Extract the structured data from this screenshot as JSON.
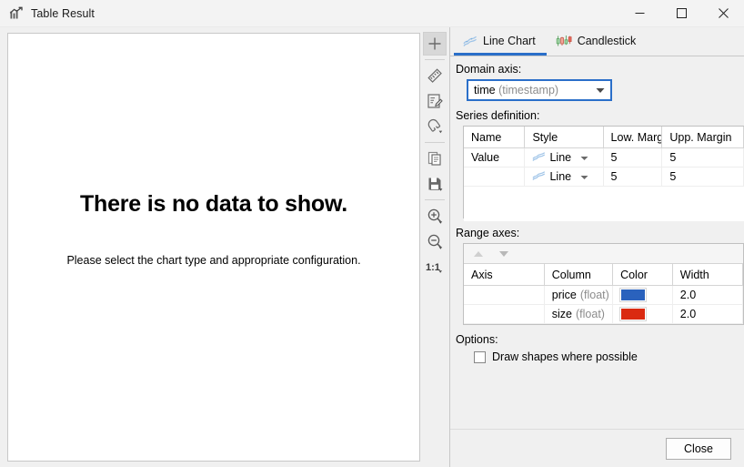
{
  "window": {
    "title": "Table Result",
    "icon": "chart-icon",
    "controls": {
      "minimize": "minimize-icon",
      "maximize": "maximize-icon",
      "close": "close-icon"
    }
  },
  "canvas": {
    "message_title": "There is no data to show.",
    "message_sub": "Please select the chart type and appropriate configuration."
  },
  "toolbar": {
    "items": [
      {
        "name": "crosshair-icon",
        "tooltip": "Select / move",
        "selected": true
      },
      {
        "name": "ruler-icon",
        "tooltip": "Measure",
        "selected": false
      },
      {
        "name": "edit-note-icon",
        "tooltip": "Annotate",
        "selected": false
      },
      {
        "name": "magnet-icon",
        "tooltip": "Snap",
        "selected": false
      },
      {
        "name": "copy-icon",
        "tooltip": "Copy",
        "selected": false
      },
      {
        "name": "save-icon",
        "tooltip": "Save",
        "selected": false
      },
      {
        "name": "zoom-in-icon",
        "tooltip": "Zoom in",
        "selected": false
      },
      {
        "name": "zoom-out-icon",
        "tooltip": "Zoom out",
        "selected": false
      },
      {
        "name": "zoom-reset-icon",
        "label": "1:1",
        "tooltip": "Zoom 1:1",
        "selected": false
      }
    ]
  },
  "tabs": [
    {
      "label": "Line Chart",
      "icon": "line-chart-icon",
      "active": true
    },
    {
      "label": "Candlestick",
      "icon": "candlestick-icon",
      "active": false
    }
  ],
  "domain_axis": {
    "label": "Domain axis:",
    "value": "time",
    "value_type": "(timestamp)",
    "arrow": "chevron-down-icon"
  },
  "series": {
    "label": "Series definition:",
    "columns": [
      "Name",
      "Style",
      "Low. Margin",
      "Upp. Margin"
    ],
    "rows": [
      {
        "name": "Value",
        "style": "Line",
        "low_margin": "5",
        "upp_margin": "5"
      },
      {
        "name": "",
        "style": "Line",
        "low_margin": "5",
        "upp_margin": "5"
      }
    ]
  },
  "range_axes": {
    "label": "Range axes:",
    "toolbar": {
      "up": "arrow-up-icon",
      "down": "arrow-down-icon"
    },
    "columns": [
      "Axis",
      "Column",
      "Color",
      "Width"
    ],
    "rows": [
      {
        "axis": "",
        "column": "price",
        "column_type": "(float)",
        "color": "#2a62bd",
        "width": "2.0"
      },
      {
        "axis": "",
        "column": "size",
        "column_type": "(float)",
        "color": "#da2a11",
        "width": "2.0"
      }
    ]
  },
  "options": {
    "label": "Options:",
    "draw_shapes": {
      "label": "Draw shapes where possible",
      "checked": false
    }
  },
  "footer": {
    "close_label": "Close"
  },
  "colors": {
    "accent": "#2a6fc9",
    "window_bg": "#f0f0f0",
    "canvas_bg": "#ffffff"
  }
}
